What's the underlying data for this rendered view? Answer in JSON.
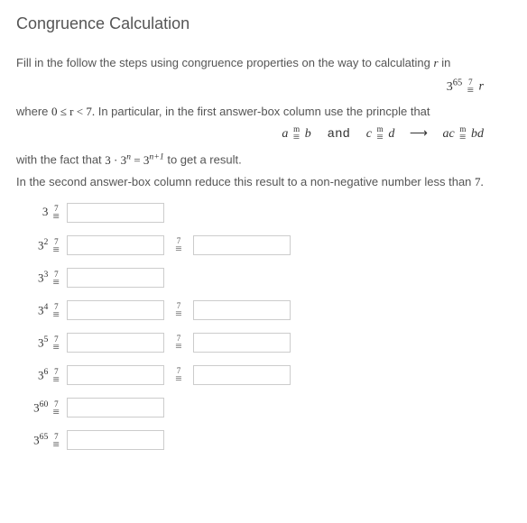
{
  "title": "Congruence Calculation",
  "intro": "Fill in the follow the steps using congruence properties on the way to calculating",
  "intro_var": "r",
  "intro_tail": "in",
  "display1": {
    "base": "3",
    "exp": "65",
    "mod": "7",
    "rhs": "r"
  },
  "cond_pre": "where",
  "cond_math": "0 ≤ r < 7.",
  "cond_post": "In particular, in the first answer-box column use the princple that",
  "principle": {
    "a": "a",
    "b": "b",
    "c": "c",
    "d": "d",
    "and": "and",
    "mod": "m",
    "ac": "ac",
    "bd": "bd"
  },
  "fact_pre": "with the fact that",
  "fact_math": "3 · 3ⁿ = 3ⁿ⁺¹",
  "fact_post": "to get a result.",
  "line2": "In the second answer-box column reduce this result to a non-negative number less than",
  "seven": "7.",
  "mod": "7",
  "rows": [
    {
      "base": "3",
      "exp": "",
      "has2": false
    },
    {
      "base": "3",
      "exp": "2",
      "has2": true
    },
    {
      "base": "3",
      "exp": "3",
      "has2": false
    },
    {
      "base": "3",
      "exp": "4",
      "has2": true
    },
    {
      "base": "3",
      "exp": "5",
      "has2": true
    },
    {
      "base": "3",
      "exp": "6",
      "has2": true
    },
    {
      "base": "3",
      "exp": "60",
      "has2": false
    },
    {
      "base": "3",
      "exp": "65",
      "has2": false
    }
  ]
}
